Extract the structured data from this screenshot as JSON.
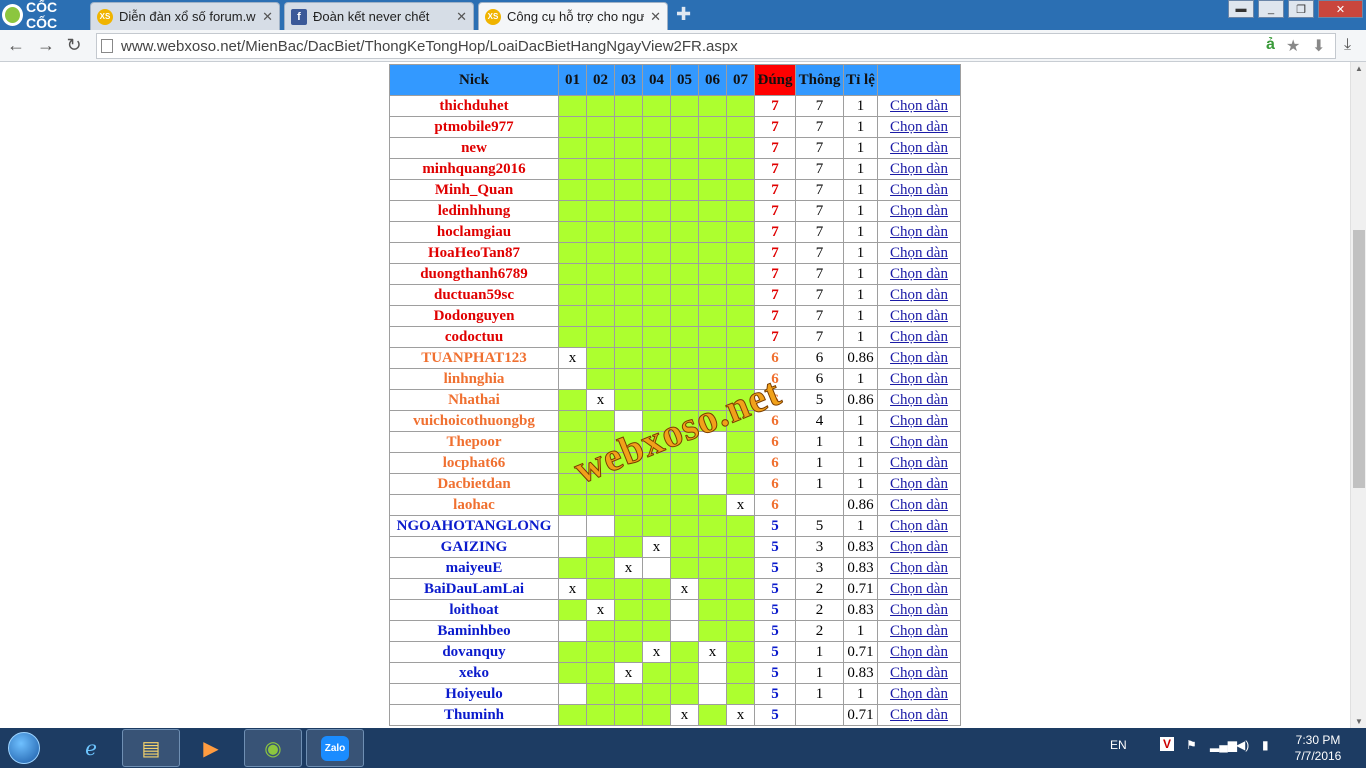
{
  "browser": {
    "brand": "CỐC CỐC",
    "tabs": [
      {
        "icon": "XS",
        "title": "Diễn đàn xổ số forum.web"
      },
      {
        "icon": "f",
        "title": "Đoàn kết never chết"
      },
      {
        "icon": "XS",
        "title": "Công cụ hỗ trợ cho người"
      }
    ],
    "url": "www.webxoso.net/MienBac/DacBiet/ThongKeTongHop/LoaiDacBietHangNgayView2FR.aspx"
  },
  "table": {
    "headers": [
      "Nick",
      "01",
      "02",
      "03",
      "04",
      "05",
      "06",
      "07",
      "Đúng",
      "Thông",
      "Tỉ lệ",
      ""
    ],
    "link_label": "Chọn dàn",
    "rows": [
      {
        "nick": "thichduhet",
        "tier": "red",
        "cells": [
          "",
          "",
          "",
          "",
          "",
          "",
          ""
        ],
        "dung": "7",
        "thong": "7",
        "tile": "1"
      },
      {
        "nick": "ptmobile977",
        "tier": "red",
        "cells": [
          "",
          "",
          "",
          "",
          "",
          "",
          ""
        ],
        "dung": "7",
        "thong": "7",
        "tile": "1"
      },
      {
        "nick": "new",
        "tier": "red",
        "cells": [
          "",
          "",
          "",
          "",
          "",
          "",
          ""
        ],
        "dung": "7",
        "thong": "7",
        "tile": "1"
      },
      {
        "nick": "minhquang2016",
        "tier": "red",
        "cells": [
          "",
          "",
          "",
          "",
          "",
          "",
          ""
        ],
        "dung": "7",
        "thong": "7",
        "tile": "1"
      },
      {
        "nick": "Minh_Quan",
        "tier": "red",
        "cells": [
          "",
          "",
          "",
          "",
          "",
          "",
          ""
        ],
        "dung": "7",
        "thong": "7",
        "tile": "1"
      },
      {
        "nick": "ledinhhung",
        "tier": "red",
        "cells": [
          "",
          "",
          "",
          "",
          "",
          "",
          ""
        ],
        "dung": "7",
        "thong": "7",
        "tile": "1"
      },
      {
        "nick": "hoclamgiau",
        "tier": "red",
        "cells": [
          "",
          "",
          "",
          "",
          "",
          "",
          ""
        ],
        "dung": "7",
        "thong": "7",
        "tile": "1"
      },
      {
        "nick": "HoaHeoTan87",
        "tier": "red",
        "cells": [
          "",
          "",
          "",
          "",
          "",
          "",
          ""
        ],
        "dung": "7",
        "thong": "7",
        "tile": "1"
      },
      {
        "nick": "duongthanh6789",
        "tier": "red",
        "cells": [
          "",
          "",
          "",
          "",
          "",
          "",
          ""
        ],
        "dung": "7",
        "thong": "7",
        "tile": "1"
      },
      {
        "nick": "ductuan59sc",
        "tier": "red",
        "cells": [
          "",
          "",
          "",
          "",
          "",
          "",
          ""
        ],
        "dung": "7",
        "thong": "7",
        "tile": "1"
      },
      {
        "nick": "Dodonguyen",
        "tier": "red",
        "cells": [
          "",
          "",
          "",
          "",
          "",
          "",
          ""
        ],
        "dung": "7",
        "thong": "7",
        "tile": "1"
      },
      {
        "nick": "codoctuu",
        "tier": "red",
        "cells": [
          "",
          "",
          "",
          "",
          "",
          "",
          ""
        ],
        "dung": "7",
        "thong": "7",
        "tile": "1"
      },
      {
        "nick": "TUANPHAT123",
        "tier": "ora",
        "cells": [
          "x",
          "",
          "",
          "",
          "",
          "",
          ""
        ],
        "dung": "6",
        "thong": "6",
        "tile": "0.86"
      },
      {
        "nick": "linhnghia",
        "tier": "ora",
        "cells": [
          "w",
          "",
          "",
          "",
          "",
          "",
          ""
        ],
        "dung": "6",
        "thong": "6",
        "tile": "1"
      },
      {
        "nick": "Nhathai",
        "tier": "ora",
        "cells": [
          "",
          "x",
          "",
          "",
          "",
          "",
          ""
        ],
        "dung": "6",
        "thong": "5",
        "tile": "0.86"
      },
      {
        "nick": "vuichoicothuongbg",
        "tier": "ora",
        "cells": [
          "",
          "",
          "w",
          "",
          "",
          "",
          ""
        ],
        "dung": "6",
        "thong": "4",
        "tile": "1"
      },
      {
        "nick": "Thepoor",
        "tier": "ora",
        "cells": [
          "",
          "",
          "",
          "",
          "",
          "w",
          ""
        ],
        "dung": "6",
        "thong": "1",
        "tile": "1"
      },
      {
        "nick": "locphat66",
        "tier": "ora",
        "cells": [
          "",
          "",
          "",
          "",
          "",
          "w",
          ""
        ],
        "dung": "6",
        "thong": "1",
        "tile": "1"
      },
      {
        "nick": "Dacbietdan",
        "tier": "ora",
        "cells": [
          "",
          "",
          "",
          "",
          "",
          "w",
          ""
        ],
        "dung": "6",
        "thong": "1",
        "tile": "1"
      },
      {
        "nick": "laohac",
        "tier": "ora",
        "cells": [
          "",
          "",
          "",
          "",
          "",
          "",
          "x"
        ],
        "dung": "6",
        "thong": "",
        "tile": "0.86"
      },
      {
        "nick": "NGOAHOTANGLONG",
        "tier": "blu",
        "cells": [
          "w",
          "w",
          "",
          "",
          "",
          "",
          ""
        ],
        "dung": "5",
        "thong": "5",
        "tile": "1"
      },
      {
        "nick": "GAIZING",
        "tier": "blu",
        "cells": [
          "w",
          "",
          "",
          "x",
          "",
          "",
          ""
        ],
        "dung": "5",
        "thong": "3",
        "tile": "0.83"
      },
      {
        "nick": "maiyeuE",
        "tier": "blu",
        "cells": [
          "",
          "",
          "x",
          "w",
          "",
          "",
          ""
        ],
        "dung": "5",
        "thong": "3",
        "tile": "0.83"
      },
      {
        "nick": "BaiDauLamLai",
        "tier": "blu",
        "cells": [
          "x",
          "",
          "",
          "",
          "x",
          "",
          ""
        ],
        "dung": "5",
        "thong": "2",
        "tile": "0.71"
      },
      {
        "nick": "loithoat",
        "tier": "blu",
        "cells": [
          "",
          "x",
          "",
          "",
          "w",
          "",
          ""
        ],
        "dung": "5",
        "thong": "2",
        "tile": "0.83"
      },
      {
        "nick": "Baminhbeo",
        "tier": "blu",
        "cells": [
          "w",
          "",
          "",
          "",
          "w",
          "",
          ""
        ],
        "dung": "5",
        "thong": "2",
        "tile": "1"
      },
      {
        "nick": "dovanquy",
        "tier": "blu",
        "cells": [
          "",
          "",
          "",
          "x",
          "",
          "x",
          ""
        ],
        "dung": "5",
        "thong": "1",
        "tile": "0.71"
      },
      {
        "nick": "xeko",
        "tier": "blu",
        "cells": [
          "",
          "",
          "x",
          "",
          "",
          "w",
          ""
        ],
        "dung": "5",
        "thong": "1",
        "tile": "0.83"
      },
      {
        "nick": "Hoiyeulo",
        "tier": "blu",
        "cells": [
          "w",
          "",
          "",
          "",
          "",
          "w",
          ""
        ],
        "dung": "5",
        "thong": "1",
        "tile": "1"
      },
      {
        "nick": "Thuminh",
        "tier": "blu",
        "cells": [
          "",
          "",
          "",
          "",
          "x",
          "",
          "x"
        ],
        "dung": "5",
        "thong": "",
        "tile": "0.71"
      }
    ]
  },
  "watermark": "webxoso.net",
  "taskbar": {
    "lang": "EN",
    "time": "7:30 PM",
    "date": "7/7/2016",
    "apps": [
      "ie",
      "explorer",
      "media",
      "coccoc",
      "zalo"
    ],
    "zalo_label": "Zalo"
  },
  "colors": {
    "header": "#3399ff",
    "dung_header": "#ff0000",
    "cell_green": "#adff2f",
    "red": "#e00000",
    "orange": "#f07030",
    "blue": "#0b1bcc"
  }
}
